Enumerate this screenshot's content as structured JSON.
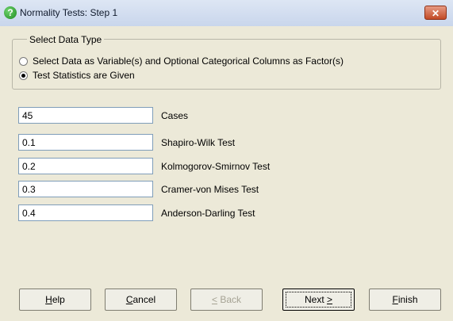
{
  "window": {
    "title": "Normality Tests: Step 1",
    "close_label": "✕"
  },
  "group": {
    "legend": "Select Data Type",
    "options": [
      {
        "label": "Select Data as Variable(s) and Optional Categorical Columns as Factor(s)",
        "selected": false
      },
      {
        "label": "Test Statistics are Given",
        "selected": true
      }
    ]
  },
  "fields": [
    {
      "value": "45",
      "label": "Cases"
    },
    {
      "value": "0.1",
      "label": "Shapiro-Wilk Test"
    },
    {
      "value": "0.2",
      "label": "Kolmogorov-Smirnov Test"
    },
    {
      "value": "0.3",
      "label": "Cramer-von Mises Test"
    },
    {
      "value": "0.4",
      "label": "Anderson-Darling Test"
    }
  ],
  "buttons": {
    "help": {
      "first": "H",
      "rest": "elp"
    },
    "cancel": {
      "first": "C",
      "rest": "ancel"
    },
    "back": {
      "first": "<",
      "rest": " Back"
    },
    "next": {
      "first": "Next ",
      "rest": ">"
    },
    "finish": {
      "first": "F",
      "rest": "inish"
    }
  }
}
